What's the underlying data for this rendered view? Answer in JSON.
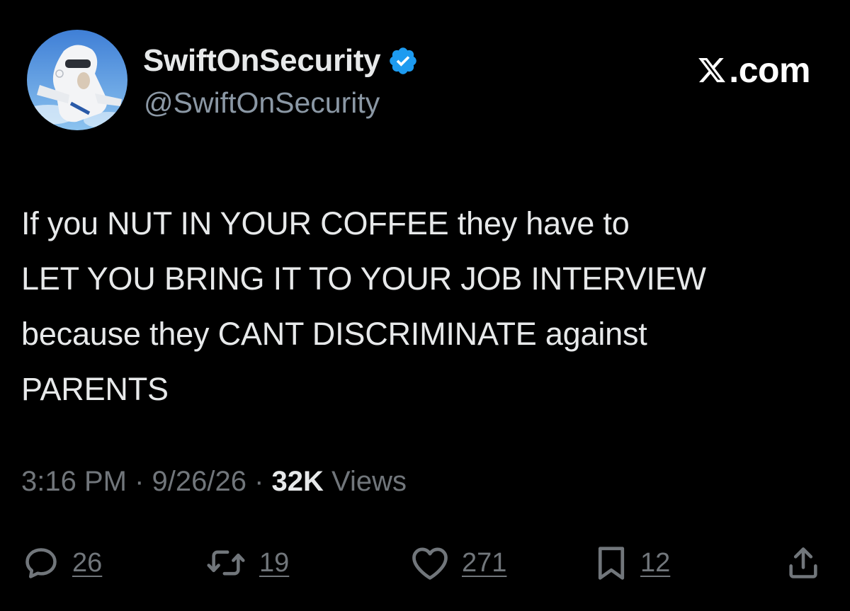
{
  "tweet": {
    "display_name": "SwiftOnSecurity",
    "handle": "@SwiftOnSecurity",
    "brand": ".com",
    "body_lines": [
      "If you NUT IN YOUR COFFEE they have to",
      "LET YOU BRING IT TO YOUR JOB INTERVIEW",
      "because they CANT DISCRIMINATE against",
      "PARENTS"
    ],
    "time": "3:16 PM",
    "date": "9/26/26",
    "separator": " · ",
    "views_count": "32K",
    "views_label": " Views"
  },
  "actions": {
    "replies": "26",
    "reposts": "19",
    "likes": "271",
    "bookmarks": "12"
  },
  "colors": {
    "background": "#000000",
    "primary_text": "#e7e9ea",
    "secondary_text": "#71767b",
    "verified_badge": "#1d9bf0"
  },
  "icons": {
    "verified": "verified-badge-icon",
    "brand": "x-logo-icon",
    "reply": "reply-bubble-icon",
    "repost": "repost-icon",
    "like": "heart-icon",
    "bookmark": "bookmark-icon",
    "share": "share-icon"
  }
}
